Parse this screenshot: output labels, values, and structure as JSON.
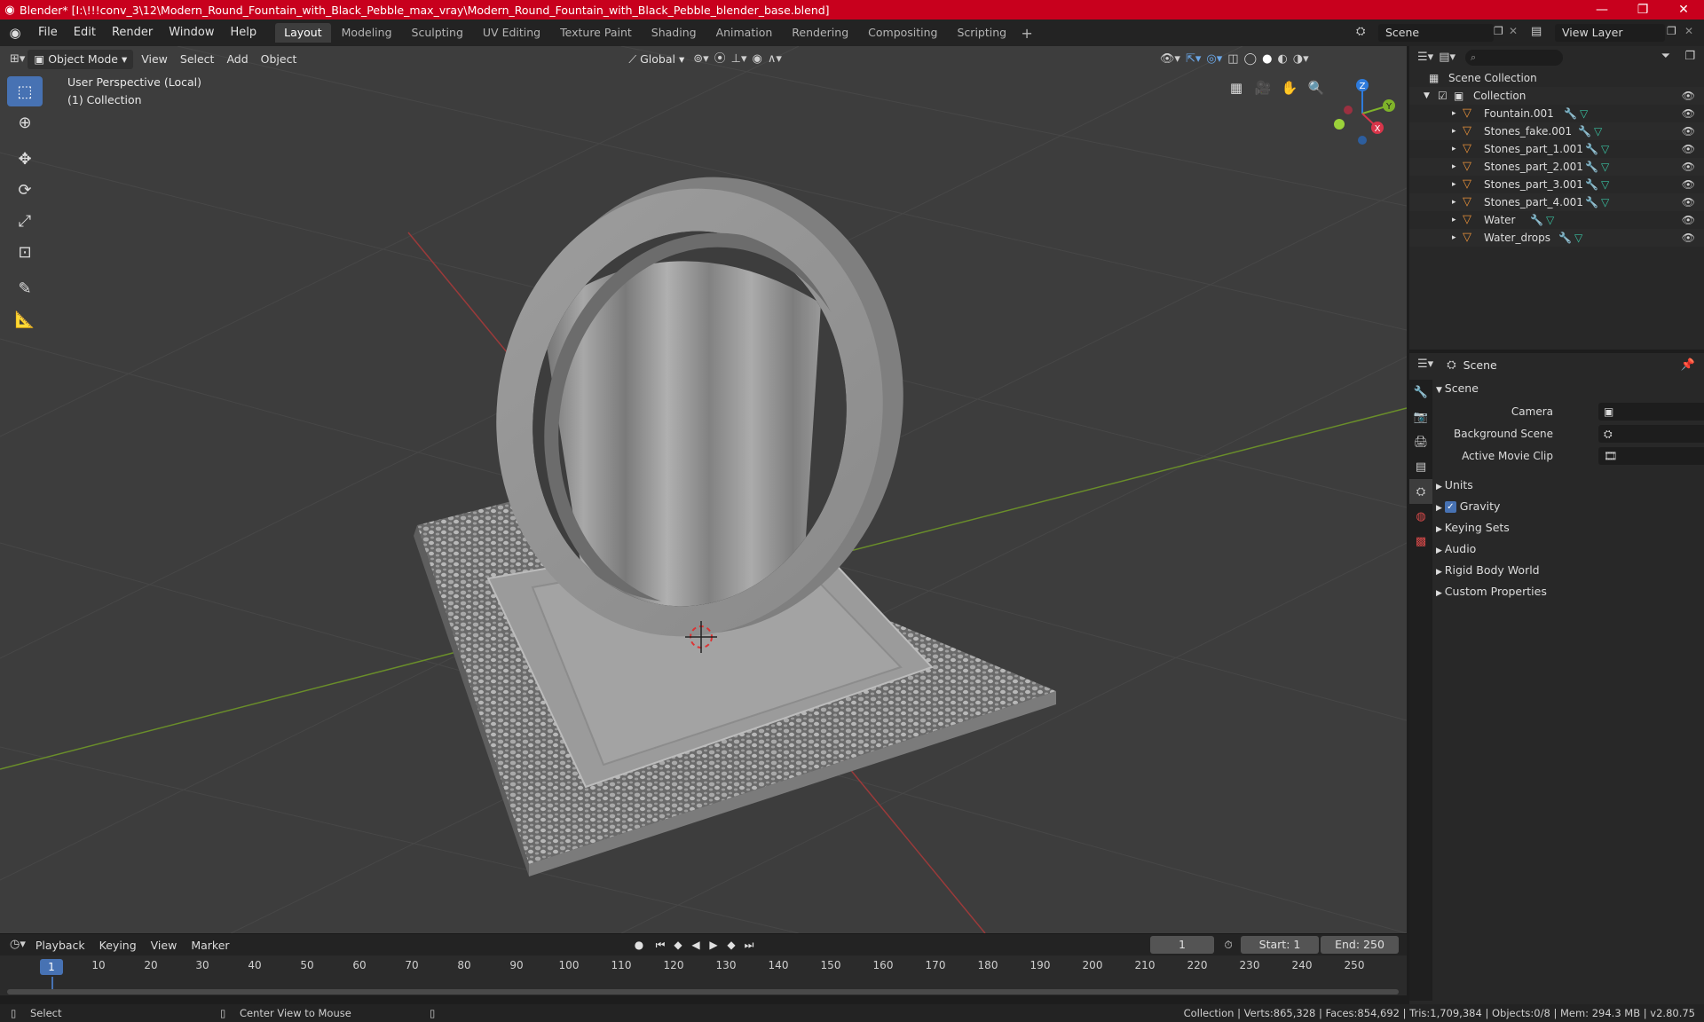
{
  "titlebar": {
    "title": "Blender* [I:\\!!!conv_3\\12\\Modern_Round_Fountain_with_Black_Pebble_max_vray\\Modern_Round_Fountain_with_Black_Pebble_blender_base.blend]",
    "bg_color": "#c8001d"
  },
  "menu": [
    "File",
    "Edit",
    "Render",
    "Window",
    "Help"
  ],
  "workspaces": [
    "Layout",
    "Modeling",
    "Sculpting",
    "UV Editing",
    "Texture Paint",
    "Shading",
    "Animation",
    "Rendering",
    "Compositing",
    "Scripting"
  ],
  "active_workspace": "Layout",
  "scene_name": "Scene",
  "view_layer": "View Layer",
  "viewport": {
    "mode": "Object Mode",
    "menus": [
      "View",
      "Select",
      "Add",
      "Object"
    ],
    "transform_orientation": "Global",
    "info_line1": "User Perspective (Local)",
    "info_line2": "(1) Collection",
    "gizmo": {
      "z": "Z",
      "y": "Y",
      "x": "X"
    }
  },
  "outliner": {
    "root": "Scene Collection",
    "collection": "Collection",
    "items": [
      "Fountain.001",
      "Stones_fake.001",
      "Stones_part_1.001",
      "Stones_part_2.001",
      "Stones_part_3.001",
      "Stones_part_4.001",
      "Water",
      "Water_drops"
    ]
  },
  "properties": {
    "header": "Scene",
    "panel": "Scene",
    "camera_label": "Camera",
    "background_scene_label": "Background Scene",
    "active_movie_clip_label": "Active Movie Clip",
    "sections": [
      "Units",
      "Gravity",
      "Keying Sets",
      "Audio",
      "Rigid Body World",
      "Custom Properties"
    ],
    "gravity_checked": true
  },
  "timeline": {
    "menus": [
      "Playback",
      "Keying",
      "View",
      "Marker"
    ],
    "current_frame": "1",
    "start_label": "Start:",
    "start": "1",
    "end_label": "End:",
    "end": "250",
    "ticks": [
      "10",
      "20",
      "30",
      "40",
      "50",
      "60",
      "70",
      "80",
      "90",
      "100",
      "110",
      "120",
      "130",
      "140",
      "150",
      "160",
      "170",
      "180",
      "190",
      "200",
      "210",
      "220",
      "230",
      "240",
      "250"
    ],
    "cursor_frame": "1"
  },
  "statusbar": {
    "left_action": "Select",
    "middle_action": "Center View to Mouse",
    "stats": "Collection | Verts:865,328 | Faces:854,692 | Tris:1,709,384 | Objects:0/8 | Mem: 294.3 MB | v2.80.75"
  }
}
